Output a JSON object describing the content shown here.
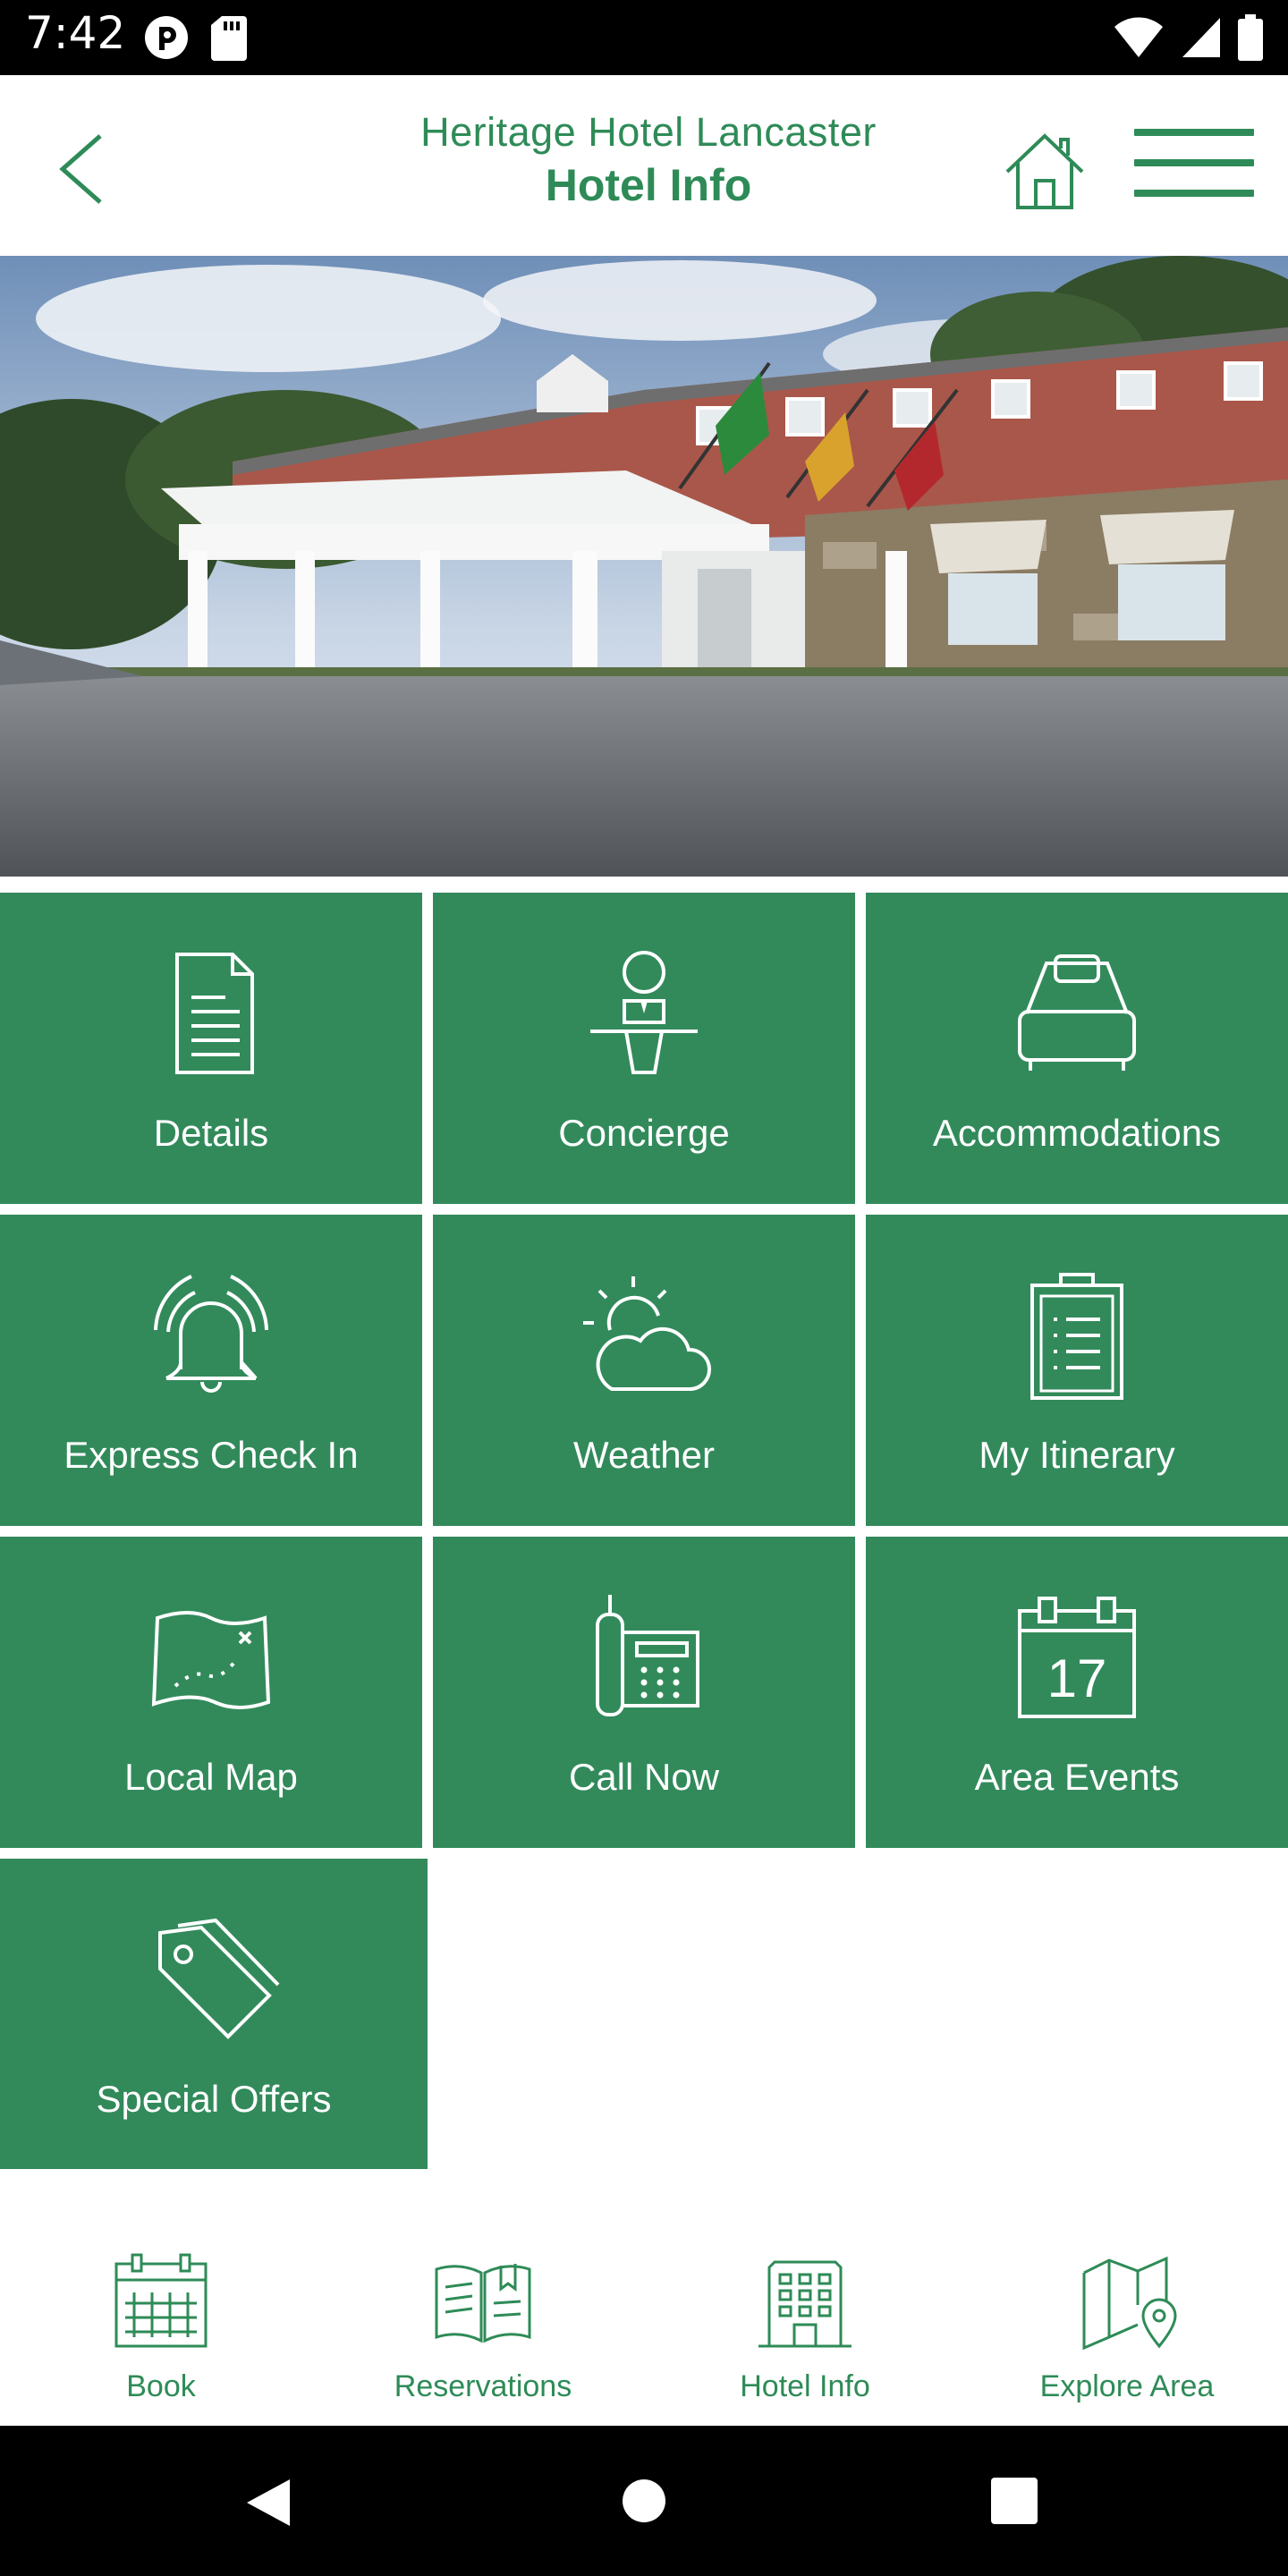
{
  "status_bar": {
    "time": "7:42"
  },
  "header": {
    "hotel_name": "Heritage Hotel Lancaster",
    "page_title": "Hotel Info"
  },
  "tiles": [
    {
      "label": "Details",
      "icon": "document-icon"
    },
    {
      "label": "Concierge",
      "icon": "concierge-icon"
    },
    {
      "label": "Accommodations",
      "icon": "bed-icon"
    },
    {
      "label": "Express Check In",
      "icon": "bell-icon"
    },
    {
      "label": "Weather",
      "icon": "weather-icon"
    },
    {
      "label": "My Itinerary",
      "icon": "clipboard-icon"
    },
    {
      "label": "Local Map",
      "icon": "map-icon"
    },
    {
      "label": "Call Now",
      "icon": "phone-icon"
    },
    {
      "label": "Area Events",
      "icon": "calendar-icon",
      "calendar_day": "17"
    },
    {
      "label": "Special Offers",
      "icon": "tag-icon"
    }
  ],
  "bottom_nav": [
    {
      "label": "Book",
      "icon": "calendar-grid-icon"
    },
    {
      "label": "Reservations",
      "icon": "open-book-icon"
    },
    {
      "label": "Hotel Info",
      "icon": "building-icon"
    },
    {
      "label": "Explore Area",
      "icon": "map-pin-icon"
    }
  ],
  "colors": {
    "brand_green": "#2e8b57",
    "tile_green": "#328a5b"
  }
}
